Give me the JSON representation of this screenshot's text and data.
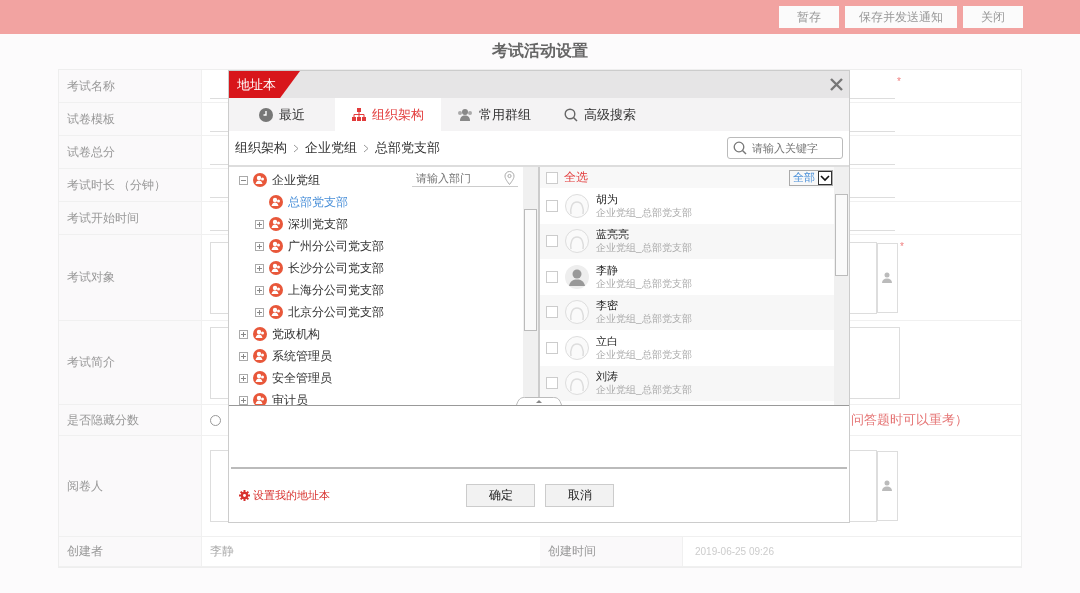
{
  "top_bar": {
    "buttons": [
      "暂存",
      "保存并发送通知",
      "关闭"
    ]
  },
  "page_title": "考试活动设置",
  "form": {
    "rows": [
      {
        "label": "考试名称",
        "kind": "line",
        "mark": "*"
      },
      {
        "label": "试卷模板",
        "kind": "line"
      },
      {
        "label": "试卷总分",
        "kind": "line"
      },
      {
        "label": "考试时长 （分钟）",
        "kind": "line"
      },
      {
        "label": "考试开始时间",
        "kind": "line"
      },
      {
        "label": "考试对象",
        "kind": "picker",
        "mark": "*"
      },
      {
        "label": "考试简介",
        "kind": "textarea"
      },
      {
        "label": "是否隐藏分数",
        "kind": "radio",
        "checked": false,
        "note": "问答题时可以重考）"
      },
      {
        "label": "阅卷人",
        "kind": "picker"
      }
    ],
    "footer_row": {
      "creator_label": "创建者",
      "creator": "李静",
      "time_label": "创建时间",
      "time": "2019-06-25 09:26"
    }
  },
  "dialog": {
    "title": "地址本",
    "tabs": [
      {
        "label": "最近",
        "selected": false
      },
      {
        "label": "组织架构",
        "selected": true
      },
      {
        "label": "常用群组",
        "selected": false
      },
      {
        "label": "高级搜索",
        "selected": false
      }
    ],
    "breadcrumb": [
      "组织架构",
      "企业党组",
      "总部党支部"
    ],
    "search": {
      "placeholder": "请输入关键字"
    },
    "dept_filter": {
      "placeholder": "请输入部门"
    },
    "tree": [
      {
        "label": "企业党组",
        "expanded": true,
        "selected": false,
        "children": [
          {
            "label": "总部党支部",
            "selected": true
          },
          {
            "label": "深圳党支部",
            "expanded": false,
            "selected": false
          },
          {
            "label": "广州分公司党支部",
            "expanded": false,
            "selected": false
          },
          {
            "label": "长沙分公司党支部",
            "expanded": false,
            "selected": false
          },
          {
            "label": "上海分公司党支部",
            "expanded": false,
            "selected": false
          },
          {
            "label": "北京分公司党支部",
            "expanded": false,
            "selected": false
          }
        ]
      },
      {
        "label": "党政机构",
        "expanded": false,
        "selected": false
      },
      {
        "label": "系统管理员",
        "expanded": false,
        "selected": false
      },
      {
        "label": "安全管理员",
        "expanded": false,
        "selected": false
      },
      {
        "label": "审计员",
        "expanded": false,
        "selected": false
      }
    ],
    "select_all": {
      "label": "全选",
      "checked": false
    },
    "filter": {
      "value": "全部"
    },
    "people": [
      {
        "name": "胡为",
        "dept": "企业党组_总部党支部",
        "kind": "outline",
        "checked": false
      },
      {
        "name": "蓝亮亮",
        "dept": "企业党组_总部党支部",
        "kind": "outline",
        "checked": false
      },
      {
        "name": "李静",
        "dept": "企业党组_总部党支部",
        "kind": "silhouette",
        "checked": false
      },
      {
        "name": "李密",
        "dept": "企业党组_总部党支部",
        "kind": "outline",
        "checked": false
      },
      {
        "name": "立白",
        "dept": "企业党组_总部党支部",
        "kind": "outline",
        "checked": false
      },
      {
        "name": "刘涛",
        "dept": "企业党组_总部党支部",
        "kind": "outline",
        "checked": false
      }
    ],
    "settings_link": "设置我的地址本",
    "buttons": [
      "确定",
      "取消"
    ]
  }
}
